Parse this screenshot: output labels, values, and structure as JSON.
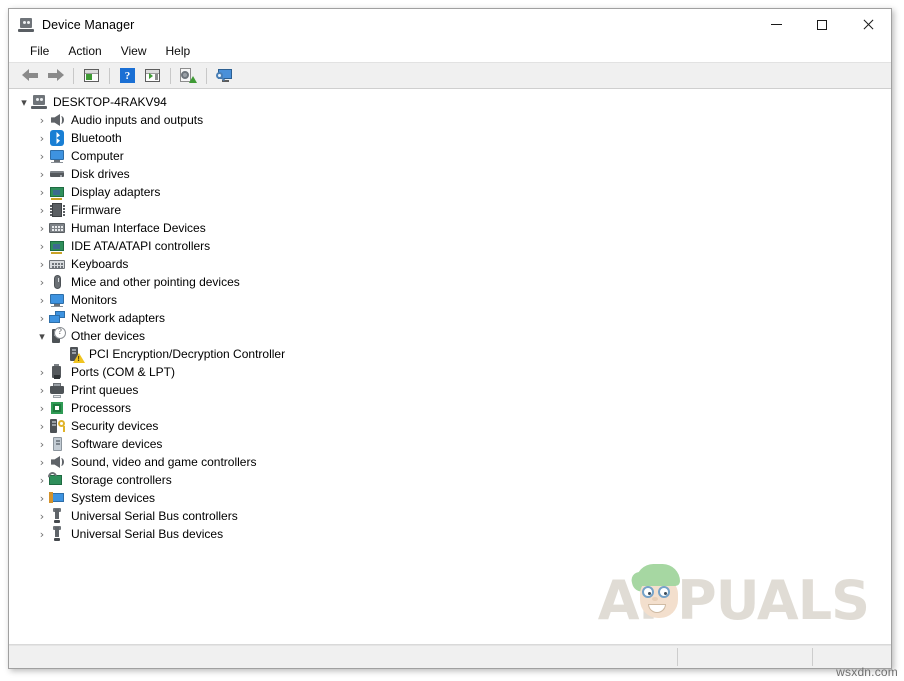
{
  "window": {
    "title": "Device Manager",
    "title_icon": "device-manager-icon",
    "controls": {
      "minimize": "minimize-icon",
      "maximize": "maximize-icon",
      "close": "close-icon"
    }
  },
  "menubar": {
    "items": [
      {
        "label": "File"
      },
      {
        "label": "Action"
      },
      {
        "label": "View"
      },
      {
        "label": "Help"
      }
    ]
  },
  "toolbar": {
    "buttons": [
      {
        "name": "back-arrow-icon"
      },
      {
        "name": "forward-arrow-icon"
      },
      {
        "name": "show-hide-console-tree-icon"
      },
      {
        "name": "help-icon"
      },
      {
        "name": "properties-icon"
      },
      {
        "name": "update-driver-icon"
      },
      {
        "name": "scan-for-hardware-changes-icon"
      }
    ]
  },
  "tree": {
    "root": {
      "label": "DESKTOP-4RAKV94",
      "expanded": true,
      "icon": "computer-icon",
      "chevron": "chevron-down"
    },
    "nodes": [
      {
        "label": "Audio inputs and outputs",
        "icon": "speaker-icon",
        "chevron": "chevron-right",
        "indent": 1
      },
      {
        "label": "Bluetooth",
        "icon": "bluetooth-icon",
        "chevron": "chevron-right",
        "indent": 1
      },
      {
        "label": "Computer",
        "icon": "monitor-icon",
        "chevron": "chevron-right",
        "indent": 1
      },
      {
        "label": "Disk drives",
        "icon": "disk-drive-icon",
        "chevron": "chevron-right",
        "indent": 1
      },
      {
        "label": "Display adapters",
        "icon": "display-adapter-icon",
        "chevron": "chevron-right",
        "indent": 1
      },
      {
        "label": "Firmware",
        "icon": "firmware-chip-icon",
        "chevron": "chevron-right",
        "indent": 1
      },
      {
        "label": "Human Interface Devices",
        "icon": "hid-icon",
        "chevron": "chevron-right",
        "indent": 1
      },
      {
        "label": "IDE ATA/ATAPI controllers",
        "icon": "ide-controller-icon",
        "chevron": "chevron-right",
        "indent": 1
      },
      {
        "label": "Keyboards",
        "icon": "keyboard-icon",
        "chevron": "chevron-right",
        "indent": 1
      },
      {
        "label": "Mice and other pointing devices",
        "icon": "mouse-icon",
        "chevron": "chevron-right",
        "indent": 1
      },
      {
        "label": "Monitors",
        "icon": "monitor-icon",
        "chevron": "chevron-right",
        "indent": 1
      },
      {
        "label": "Network adapters",
        "icon": "network-adapter-icon",
        "chevron": "chevron-right",
        "indent": 1
      },
      {
        "label": "Other devices",
        "icon": "unknown-device-icon",
        "chevron": "chevron-down",
        "indent": 1,
        "expanded": true
      },
      {
        "label": "PCI Encryption/Decryption Controller",
        "icon": "warning-device-icon",
        "chevron": "none",
        "indent": 2,
        "warning": true
      },
      {
        "label": "Ports (COM & LPT)",
        "icon": "port-icon",
        "chevron": "chevron-right",
        "indent": 1
      },
      {
        "label": "Print queues",
        "icon": "printer-icon",
        "chevron": "chevron-right",
        "indent": 1
      },
      {
        "label": "Processors",
        "icon": "processor-icon",
        "chevron": "chevron-right",
        "indent": 1
      },
      {
        "label": "Security devices",
        "icon": "security-device-icon",
        "chevron": "chevron-right",
        "indent": 1
      },
      {
        "label": "Software devices",
        "icon": "software-device-icon",
        "chevron": "chevron-right",
        "indent": 1
      },
      {
        "label": "Sound, video and game controllers",
        "icon": "speaker-icon",
        "chevron": "chevron-right",
        "indent": 1
      },
      {
        "label": "Storage controllers",
        "icon": "storage-controller-icon",
        "chevron": "chevron-right",
        "indent": 1
      },
      {
        "label": "System devices",
        "icon": "system-device-icon",
        "chevron": "chevron-right",
        "indent": 1
      },
      {
        "label": "Universal Serial Bus controllers",
        "icon": "usb-icon",
        "chevron": "chevron-right",
        "indent": 1
      },
      {
        "label": "Universal Serial Bus devices",
        "icon": "usb-icon",
        "chevron": "chevron-right",
        "indent": 1
      }
    ]
  },
  "statusbar": {
    "segments": [
      "",
      "",
      ""
    ]
  },
  "watermark": {
    "text": "APPUALS",
    "mascot": "appuals-mascot-icon"
  },
  "site_tag": "wsxdn.com",
  "colors": {
    "window_border": "#a0a0a0",
    "toolbar_bg": "#f0f0f0",
    "statusbar_bg": "#f0f0f0",
    "accent_blue": "#1a7fd4",
    "warning_yellow": "#f0c420",
    "watermark": "#dedad2"
  }
}
